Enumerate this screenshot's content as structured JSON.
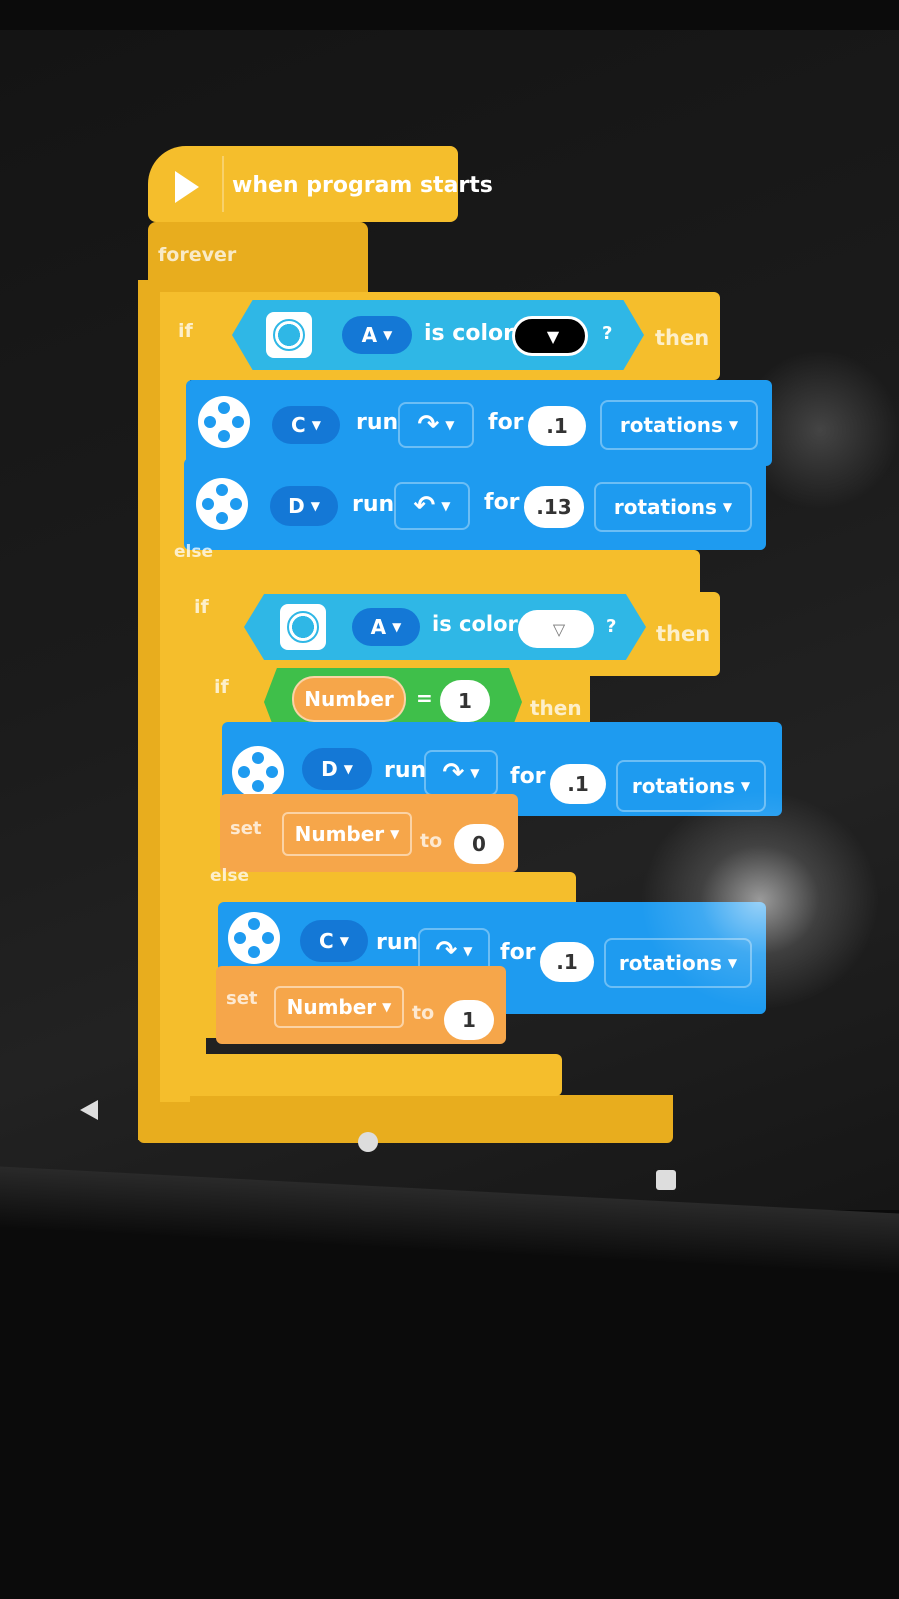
{
  "start": {
    "label": "when program starts"
  },
  "forever": {
    "label": "forever"
  },
  "if1": {
    "if_label": "if",
    "then_label": "then",
    "port": "A",
    "is_color": "is color",
    "question": "?",
    "else_label": "else"
  },
  "run1": {
    "port": "C",
    "run": "run",
    "for": "for",
    "value": ".1",
    "unit": "rotations",
    "direction": "clockwise-icon"
  },
  "run2": {
    "port": "D",
    "run": "run",
    "for": "for",
    "value": ".13",
    "unit": "rotations",
    "direction": "counterclockwise-icon"
  },
  "if2": {
    "if_label": "if",
    "then_label": "then",
    "port": "A",
    "is_color": "is color",
    "question": "?"
  },
  "if3": {
    "if_label": "if",
    "then_label": "then",
    "variable": "Number",
    "operator": "=",
    "value": "1",
    "else_label": "else"
  },
  "run3": {
    "port": "D",
    "run": "run",
    "for": "for",
    "value": ".1",
    "unit": "rotations",
    "direction": "clockwise-icon"
  },
  "set1": {
    "set": "set",
    "variable": "Number",
    "to": "to",
    "value": "0"
  },
  "run4": {
    "port": "C",
    "run": "run",
    "for": "for",
    "value": ".1",
    "unit": "rotations",
    "direction": "clockwise-icon"
  },
  "set2": {
    "set": "set",
    "variable": "Number",
    "to": "to",
    "value": "1"
  },
  "colors": {
    "event": "#f5be2c",
    "motor": "#1e9bf0",
    "variable": "#f6a64a",
    "sensor": "#2fb7e6",
    "operator": "#3fbf4a"
  }
}
